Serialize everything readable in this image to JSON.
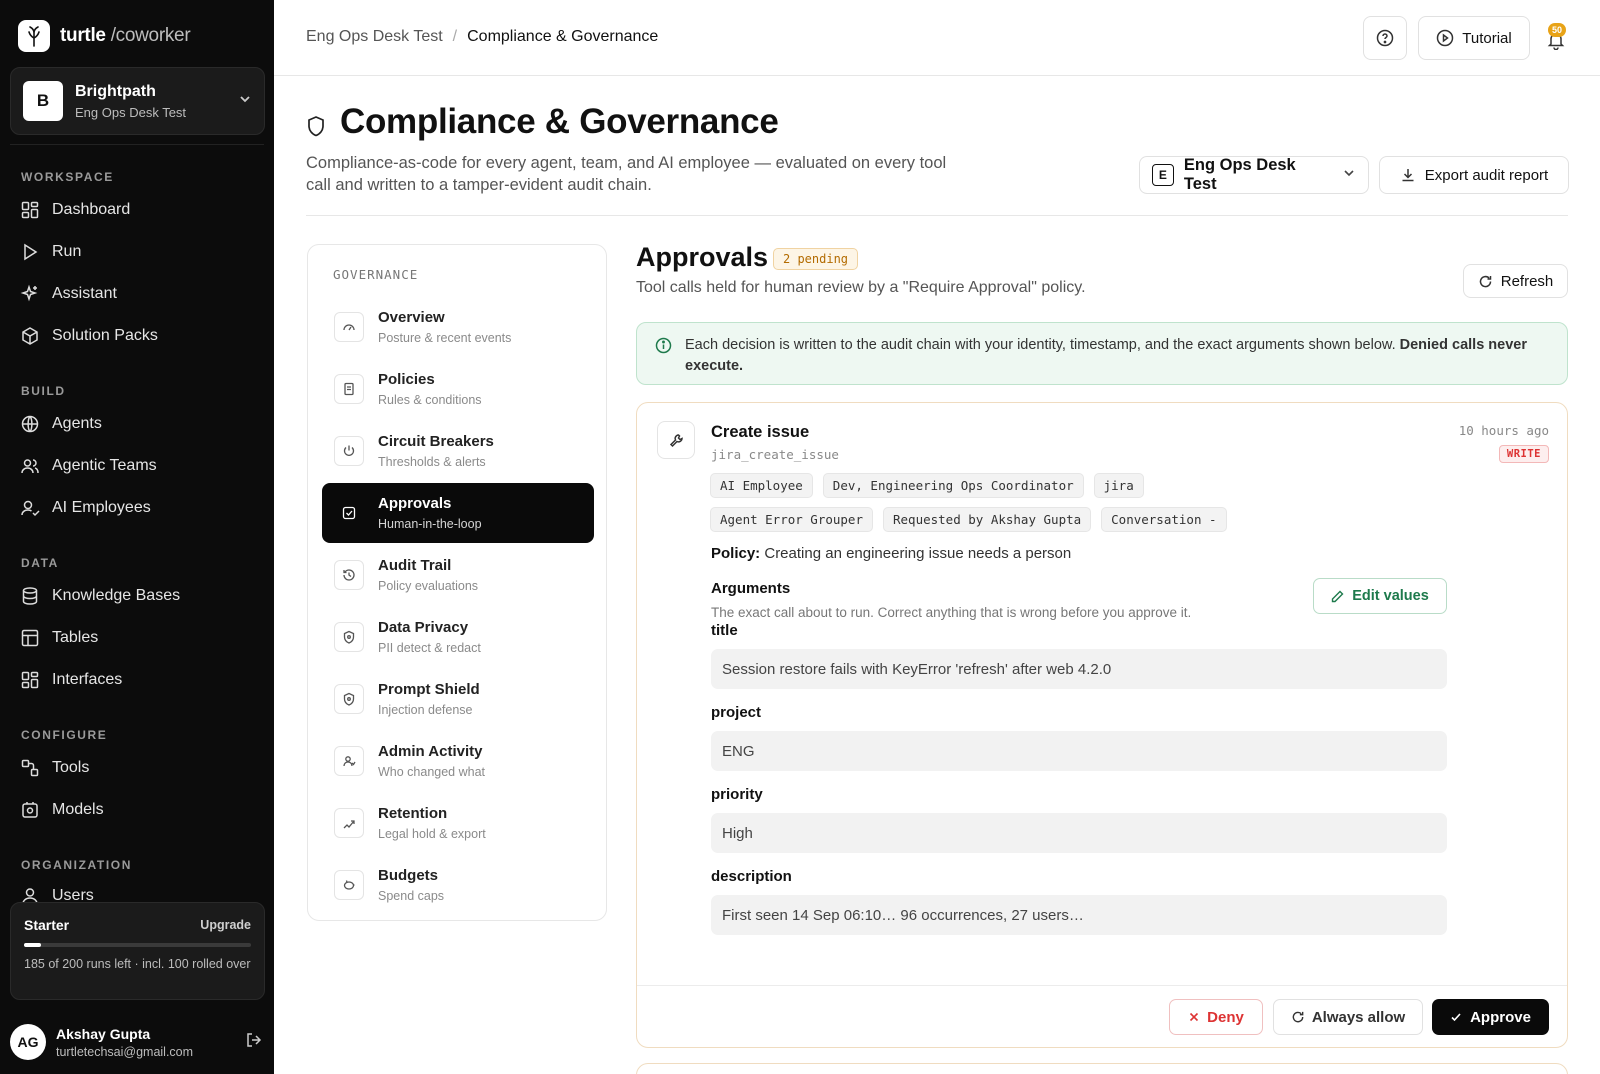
{
  "brand": {
    "name": "turtle",
    "suffix": "/coworker"
  },
  "workspace": {
    "initial": "B",
    "name": "Brightpath",
    "sub": "Eng Ops Desk Test"
  },
  "sidebar": {
    "sections": [
      "WORKSPACE",
      "BUILD",
      "DATA",
      "CONFIGURE",
      "ORGANIZATION"
    ],
    "items": [
      {
        "label": "Dashboard",
        "icon": "dashboard-icon"
      },
      {
        "label": "Run",
        "icon": "play-icon"
      },
      {
        "label": "Assistant",
        "icon": "sparkle-icon"
      },
      {
        "label": "Solution Packs",
        "icon": "package-icon"
      },
      {
        "label": "Agents",
        "icon": "globe-icon"
      },
      {
        "label": "Agentic Teams",
        "icon": "users-icon"
      },
      {
        "label": "AI Employees",
        "icon": "user-check-icon"
      },
      {
        "label": "Knowledge Bases",
        "icon": "database-icon"
      },
      {
        "label": "Tables",
        "icon": "table-icon"
      },
      {
        "label": "Interfaces",
        "icon": "layout-icon"
      },
      {
        "label": "Tools",
        "icon": "tools-icon"
      },
      {
        "label": "Models",
        "icon": "model-icon"
      },
      {
        "label": "Users",
        "icon": "user-icon"
      }
    ]
  },
  "plan": {
    "name": "Starter",
    "upgrade": "Upgrade",
    "usage_fraction": 0.075,
    "desc": "185 of 200 runs left · incl. 100 rolled over"
  },
  "user": {
    "initials": "AG",
    "name": "Akshay Gupta",
    "email": "turtletechsai@gmail.com"
  },
  "topbar": {
    "crumb1": "Eng Ops Desk Test",
    "crumb_sep": "/",
    "crumb2": "Compliance & Governance",
    "tutorial": "Tutorial",
    "notif_count": "50"
  },
  "header": {
    "title": "Compliance & Governance",
    "desc": "Compliance-as-code for every agent, team, and AI employee — evaluated on every tool call and written to a tamper-evident audit chain.",
    "ws_initial": "E",
    "ws_name": "Eng Ops Desk Test",
    "export": "Export audit report"
  },
  "governance": {
    "title": "GOVERNANCE",
    "items": [
      {
        "name": "Overview",
        "sub": "Posture & recent events"
      },
      {
        "name": "Policies",
        "sub": "Rules & conditions"
      },
      {
        "name": "Circuit Breakers",
        "sub": "Thresholds & alerts"
      },
      {
        "name": "Approvals",
        "sub": "Human-in-the-loop"
      },
      {
        "name": "Audit Trail",
        "sub": "Policy evaluations"
      },
      {
        "name": "Data Privacy",
        "sub": "PII detect & redact"
      },
      {
        "name": "Prompt Shield",
        "sub": "Injection defense"
      },
      {
        "name": "Admin Activity",
        "sub": "Who changed what"
      },
      {
        "name": "Retention",
        "sub": "Legal hold & export"
      },
      {
        "name": "Budgets",
        "sub": "Spend caps"
      }
    ]
  },
  "approvals": {
    "title": "Approvals",
    "pending": "2 pending",
    "desc": "Tool calls held for human review by a \"Require Approval\" policy.",
    "refresh": "Refresh",
    "info_text": "Each decision is written to the audit chain with your identity, timestamp, and the exact arguments shown below. ",
    "info_bold": "Denied calls never execute."
  },
  "card": {
    "name": "Create issue",
    "fn": "jira_create_issue",
    "time": "10 hours ago",
    "badge": "WRITE",
    "tags": [
      "AI Employee",
      "Dev, Engineering Ops Coordinator",
      "jira",
      "Agent Error Grouper",
      "Requested by Akshay Gupta",
      "Conversation -"
    ],
    "policy_label": "Policy:",
    "policy": "Creating an engineering issue needs a person",
    "args_title": "Arguments",
    "args_sub": "The exact call about to run. Correct anything that is wrong before you approve it.",
    "edit": "Edit values",
    "fields": [
      {
        "label": "title",
        "value": "Session restore fails with KeyError 'refresh' after web 4.2.0"
      },
      {
        "label": "project",
        "value": "ENG"
      },
      {
        "label": "priority",
        "value": "High"
      },
      {
        "label": "description",
        "value": "First seen 14 Sep 06:10… 96 occurrences, 27 users…"
      }
    ],
    "deny": "Deny",
    "always": "Always allow",
    "approve": "Approve"
  }
}
